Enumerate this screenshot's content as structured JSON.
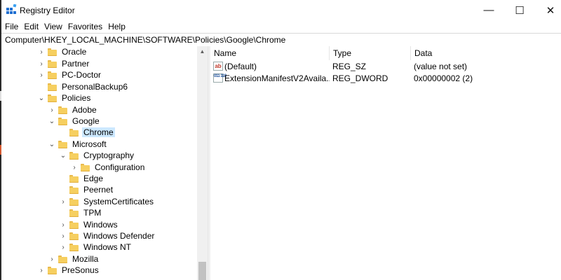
{
  "window": {
    "title": "Registry Editor",
    "controls": {
      "minimize": "—",
      "maximize": "☐",
      "close": "✕"
    }
  },
  "menu": [
    "File",
    "Edit",
    "View",
    "Favorites",
    "Help"
  ],
  "address": "Computer\\HKEY_LOCAL_MACHINE\\SOFTWARE\\Policies\\Google\\Chrome",
  "tree": [
    {
      "label": "Oracle",
      "expander": "›"
    },
    {
      "label": "Partner",
      "expander": "›"
    },
    {
      "label": "PC-Doctor",
      "expander": "›"
    },
    {
      "label": "PersonalBackup6",
      "expander": ""
    },
    {
      "label": "Policies",
      "expander": "⌄"
    },
    {
      "label": "Adobe",
      "expander": "›"
    },
    {
      "label": "Google",
      "expander": "⌄"
    },
    {
      "label": "Chrome",
      "expander": "",
      "selected": true
    },
    {
      "label": "Microsoft",
      "expander": "⌄"
    },
    {
      "label": "Cryptography",
      "expander": "⌄"
    },
    {
      "label": "Configuration",
      "expander": "›"
    },
    {
      "label": "Edge",
      "expander": ""
    },
    {
      "label": "Peernet",
      "expander": ""
    },
    {
      "label": "SystemCertificates",
      "expander": "›"
    },
    {
      "label": "TPM",
      "expander": ""
    },
    {
      "label": "Windows",
      "expander": "›"
    },
    {
      "label": "Windows Defender",
      "expander": "›"
    },
    {
      "label": "Windows NT",
      "expander": "›"
    },
    {
      "label": "Mozilla",
      "expander": "›"
    },
    {
      "label": "PreSonus",
      "expander": "›"
    }
  ],
  "values": {
    "headers": {
      "name": "Name",
      "type": "Type",
      "data": "Data"
    },
    "rows": [
      {
        "icon": "ab",
        "name": "(Default)",
        "type": "REG_SZ",
        "data": "(value not set)"
      },
      {
        "icon": "011 110",
        "name": "ExtensionManifestV2Availa...",
        "type": "REG_DWORD",
        "data": "0x00000002 (2)"
      }
    ]
  },
  "colors": {
    "selection": "#cce8ff",
    "folder": "#f6cf60"
  }
}
